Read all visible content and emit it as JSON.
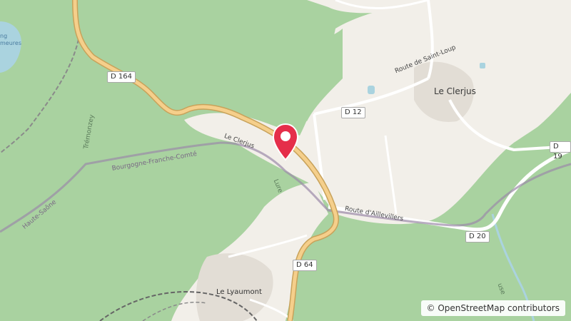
{
  "map": {
    "labels": {
      "town_le_clerjus": "Le Clerjus",
      "village_le_lyaumont": "Le Lyaumont",
      "street_route_saint_loup": "Route de Saint-Loup",
      "street_route_aillevillers": "Route d'Aillevillers",
      "road_le_clerjus": "Le Clerjus",
      "river_lure": "Lure",
      "stream_tremonzey": "Trémonzey",
      "region_bourgogne": "Bourgogne-Franche-Comté",
      "region_haute_saone": "Haute-Saône",
      "lake_fragment": "ng\nmeures",
      "river_fragment": "use"
    },
    "shields": {
      "d164": "D 164",
      "d12": "D 12",
      "d64": "D 64",
      "d20": "D 20",
      "d19": "D 19"
    },
    "attribution": "© OpenStreetMap contributors",
    "colors": {
      "forest": "#a9d2a0",
      "open_land": "#f2efe9",
      "road_major": "#f5cf8b",
      "road_major_casing": "#c8a25a",
      "water": "#aad3df",
      "boundary": "#9b8aa8",
      "marker": "#e52e4a"
    }
  }
}
